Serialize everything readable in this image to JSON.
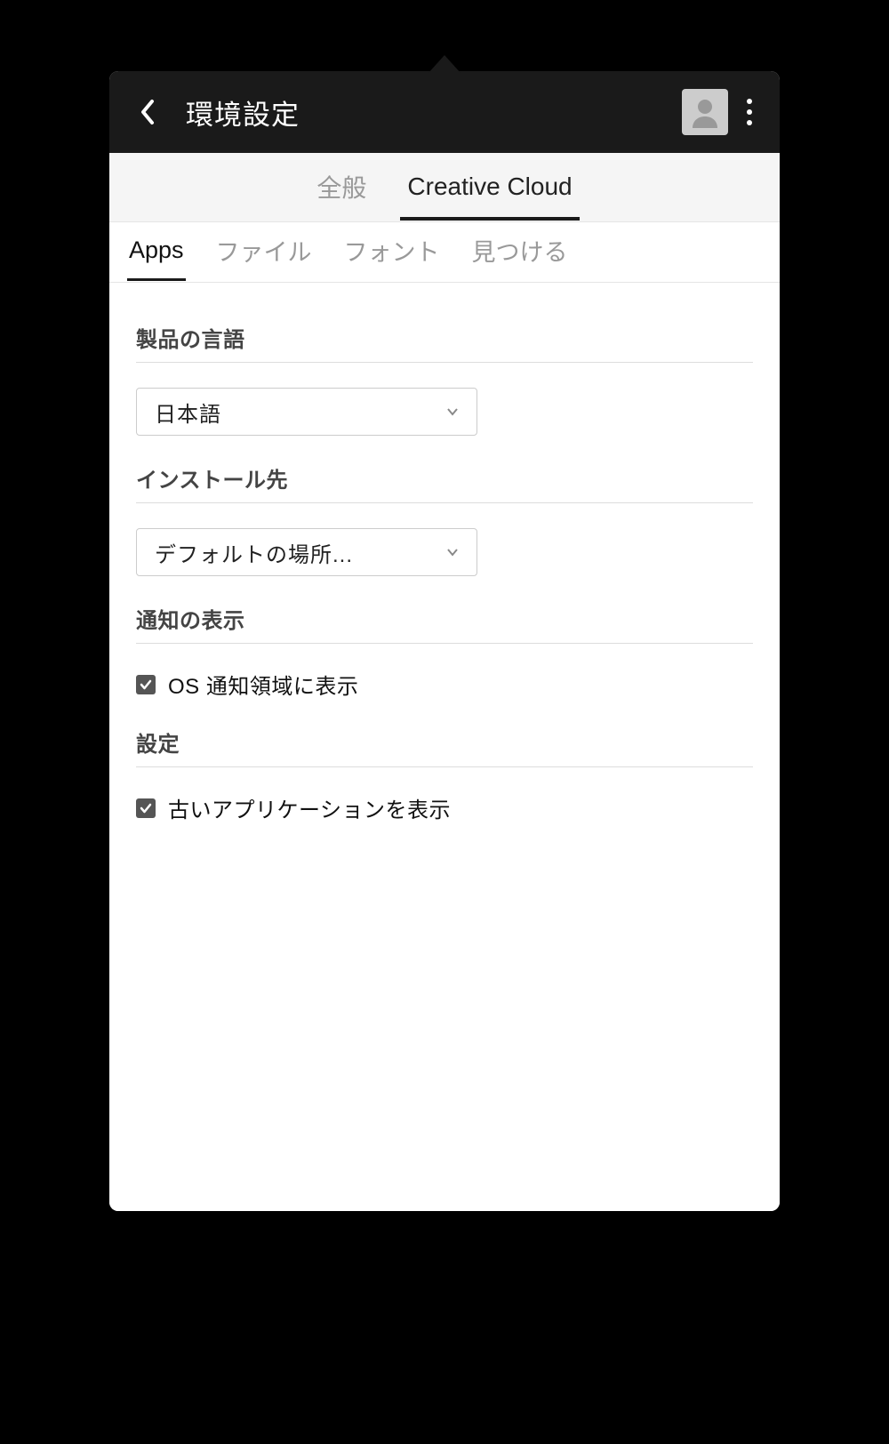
{
  "header": {
    "title": "環境設定"
  },
  "tabs_primary": {
    "general": "全般",
    "creative_cloud": "Creative Cloud"
  },
  "tabs_secondary": {
    "apps": "Apps",
    "files": "ファイル",
    "fonts": "フォント",
    "find": "見つける"
  },
  "sections": {
    "language": {
      "label": "製品の言語",
      "selected": "日本語"
    },
    "install": {
      "label": "インストール先",
      "selected": "デフォルトの場所..."
    },
    "notify": {
      "label": "通知の表示",
      "checkbox": "OS 通知領域に表示"
    },
    "settings": {
      "label": "設定",
      "checkbox": "古いアプリケーションを表示"
    }
  }
}
